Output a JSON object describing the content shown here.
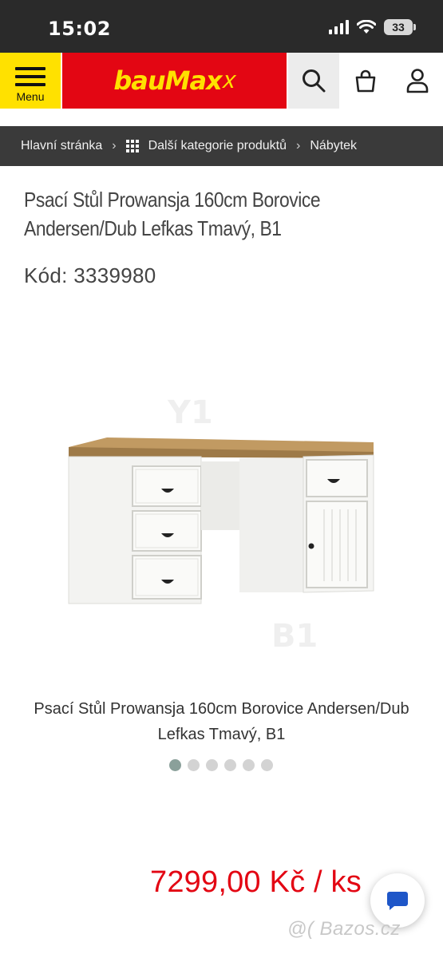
{
  "status_bar": {
    "time": "15:02",
    "battery": "33",
    "icons": [
      "cellular-signal-icon",
      "wifi-icon",
      "battery-icon"
    ]
  },
  "header": {
    "menu_label": "Menu",
    "logo_text": "bauMax",
    "logo_suffix": "x",
    "search_icon": "search-icon",
    "cart_icon": "shopping-bag-icon",
    "account_icon": "user-icon",
    "colors": {
      "menu_bg": "#ffe100",
      "logo_bg": "#e30613",
      "logo_text": "#ffe100"
    }
  },
  "breadcrumb": {
    "home": "Hlavní stránka",
    "categories": "Další kategorie produktů",
    "current": "Nábytek"
  },
  "product": {
    "title": "Psací Stůl Prowansja 160cm Borovice Andersen/Dub Lefkas Tmavý, B1",
    "code": "Kód: 3339980",
    "image_caption": "Psací Stůl Prowansja 160cm Borovice Andersen/Dub Lefkas Tmavý, B1",
    "gallery_total": 6,
    "gallery_active": 1,
    "price": "7299,00 Kč / ks"
  },
  "chat": {
    "icon": "chat-icon"
  },
  "watermark": {
    "text": "Bazos.cz"
  }
}
